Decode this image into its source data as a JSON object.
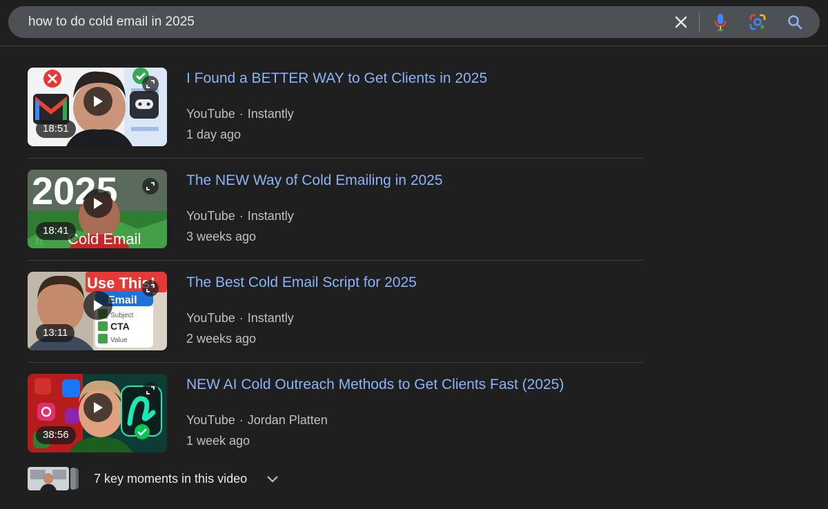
{
  "search": {
    "query": "how to do cold email in 2025",
    "clear_icon": "close-icon",
    "voice_icon": "microphone-icon",
    "lens_icon": "google-lens-icon",
    "search_icon": "search-icon"
  },
  "results": [
    {
      "title": "I Found a BETTER WAY to Get Clients in 2025",
      "source": "YouTube",
      "channel": "Instantly",
      "age": "1 day ago",
      "duration": "18:51"
    },
    {
      "title": "The NEW Way of Cold Emailing in 2025",
      "source": "YouTube",
      "channel": "Instantly",
      "age": "3 weeks ago",
      "duration": "18:41",
      "thumb_text": {
        "year": "2025",
        "caption": "Cold Email"
      }
    },
    {
      "title": "The Best Cold Email Script for 2025",
      "source": "YouTube",
      "channel": "Instantly",
      "age": "2 weeks ago",
      "duration": "13:11",
      "thumb_text": {
        "banner": "Use This!",
        "heading": "Email",
        "item1": "Subject",
        "item2": "CTA",
        "item3": "Value"
      }
    },
    {
      "title": "NEW AI Cold Outreach Methods to Get Clients Fast (2025)",
      "source": "YouTube",
      "channel": "Jordan Platten",
      "age": "1 week ago",
      "duration": "38:56"
    }
  ],
  "key_moments": {
    "label": "7 key moments in this video",
    "icon": "chevron-down-icon"
  },
  "colors": {
    "background": "#1f1f1f",
    "search_bar": "#4d5156",
    "link": "#8ab4f8",
    "meta_text": "#bdc1c6"
  }
}
